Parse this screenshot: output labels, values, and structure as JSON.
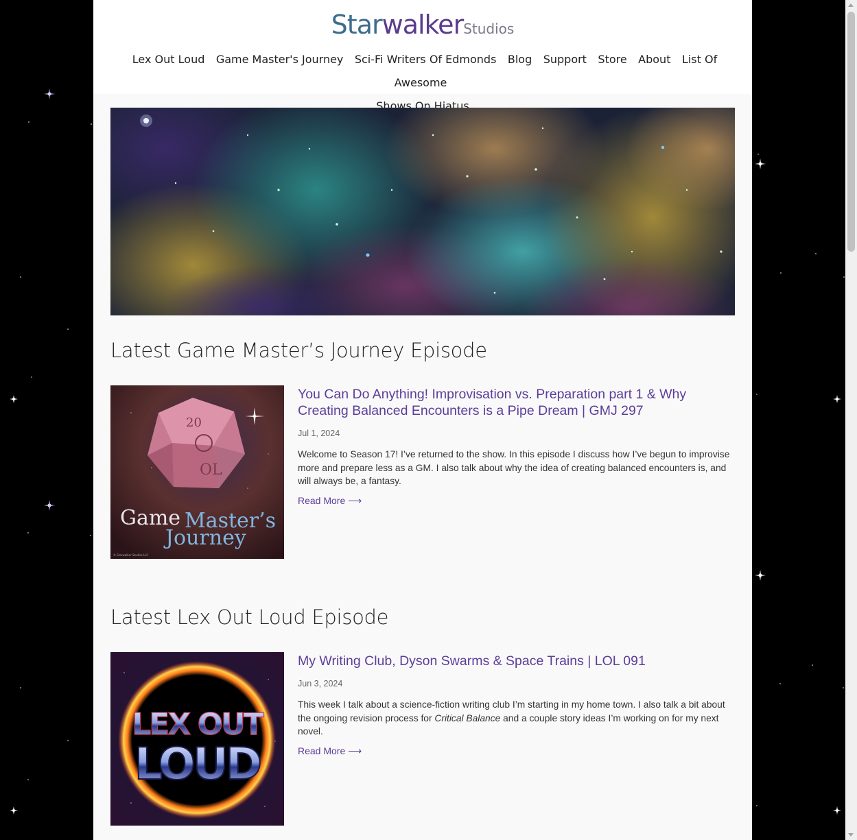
{
  "logo": {
    "part1": "Star",
    "part2": "walker",
    "part3": "Studios"
  },
  "nav": {
    "items": [
      "Lex Out Loud",
      "Game Master's Journey",
      "Sci-Fi Writers Of Edmonds",
      "Blog",
      "Support",
      "Store",
      "About",
      "List Of Awesome",
      "Shows On Hiatus"
    ]
  },
  "sections": [
    {
      "heading": "Latest Game Master’s Journey Episode",
      "art_text": {
        "word1": "Game",
        "word2": "Master’s",
        "word3": "Journey",
        "copyright": "© Starwalker Studios LLC"
      },
      "title": "You Can Do Anything! Improvisation vs. Preparation part 1 & Why Creating Balanced Encounters is a Pipe Dream | GMJ 297",
      "date": "Jul 1, 2024",
      "excerpt": "Welcome to Season 17! I’ve returned to the show. In this episode I discuss how I’ve begun to improvise more and prepare less as a GM. I also talk about why the idea of creating balanced encounters is, and will always be, a fantasy.",
      "read_more": "Read More ⟶"
    },
    {
      "heading": "Latest Lex Out Loud Episode",
      "art_text": {
        "line1": "LEX OUT",
        "line2": "LOUD"
      },
      "title": "My Writing Club, Dyson Swarms & Space Trains | LOL 091",
      "date": "Jun 3, 2024",
      "excerpt_before": "This week I talk about a science-fiction writing club I’m starting in my home town. I also talk a bit about the ongoing revision process for ",
      "excerpt_em": "Critical Balance",
      "excerpt_after": " and a couple story ideas I’m working on for my next novel.",
      "read_more": "Read More ⟶"
    }
  ],
  "colors": {
    "accent": "#5c3d99",
    "logo_blue": "#3d6d8c",
    "logo_purple": "#5b3b8c",
    "background": "#000000",
    "page": "#f9f9f9"
  }
}
